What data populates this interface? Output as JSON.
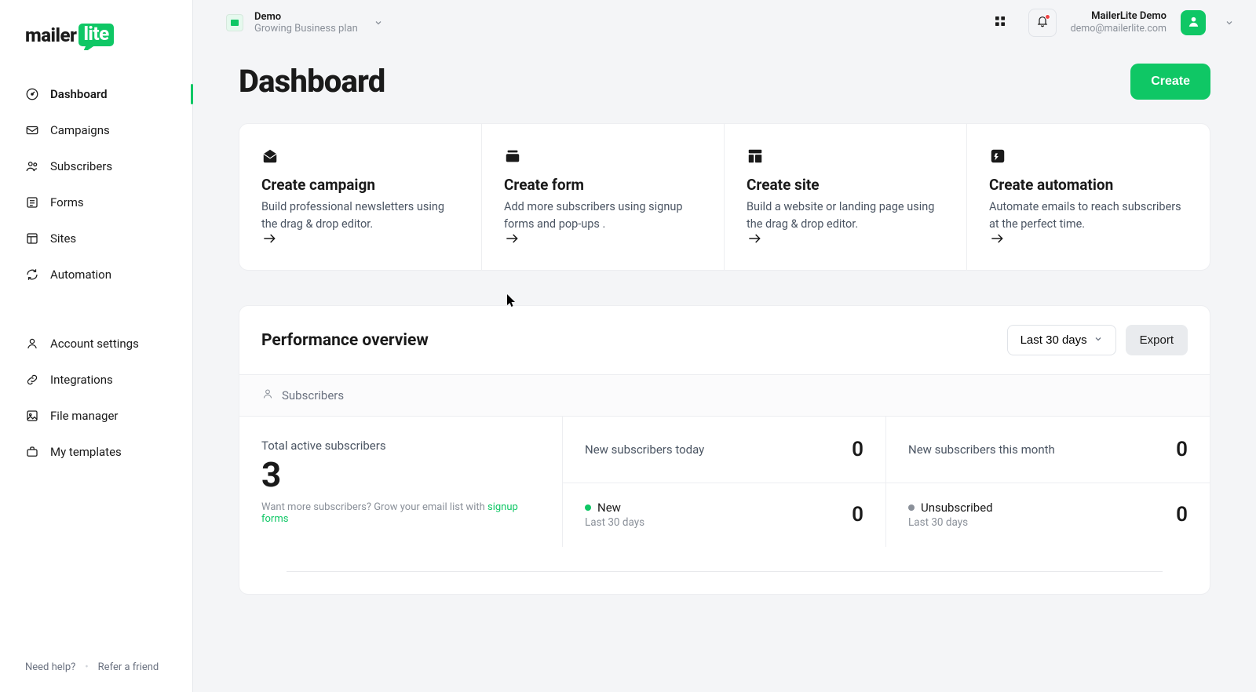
{
  "brand": {
    "a": "mailer",
    "b": "lite"
  },
  "account": {
    "name": "Demo",
    "plan": "Growing Business plan"
  },
  "user": {
    "name": "MailerLite Demo",
    "email": "demo@mailerlite.com"
  },
  "nav": {
    "dashboard": "Dashboard",
    "campaigns": "Campaigns",
    "subscribers": "Subscribers",
    "forms": "Forms",
    "sites": "Sites",
    "automation": "Automation",
    "account_settings": "Account settings",
    "integrations": "Integrations",
    "file_manager": "File manager",
    "my_templates": "My templates"
  },
  "footer": {
    "help": "Need help?",
    "refer": "Refer a friend"
  },
  "page": {
    "title": "Dashboard",
    "create": "Create"
  },
  "cards": {
    "campaign": {
      "title": "Create campaign",
      "desc": "Build professional newsletters using the drag & drop editor."
    },
    "form": {
      "title": "Create form",
      "desc": "Add more subscribers using signup forms and pop-ups ."
    },
    "site": {
      "title": "Create site",
      "desc": "Build a website or landing page using the drag & drop editor."
    },
    "automation": {
      "title": "Create automation",
      "desc": "Automate emails to reach subscribers at the perfect time."
    }
  },
  "perf": {
    "title": "Performance overview",
    "range": "Last 30 days",
    "export": "Export",
    "tab": "Subscribers",
    "total_label": "Total active subscribers",
    "total_value": "3",
    "hint_pre": "Want more subscribers? ",
    "hint_mid": "Grow your email list with ",
    "hint_link": "signup forms",
    "today_label": "New subscribers today",
    "today_value": "0",
    "month_label": "New subscribers this month",
    "month_value": "0",
    "new_label": "New",
    "new_sub": "Last 30 days",
    "new_value": "0",
    "unsub_label": "Unsubscribed",
    "unsub_sub": "Last 30 days",
    "unsub_value": "0"
  }
}
